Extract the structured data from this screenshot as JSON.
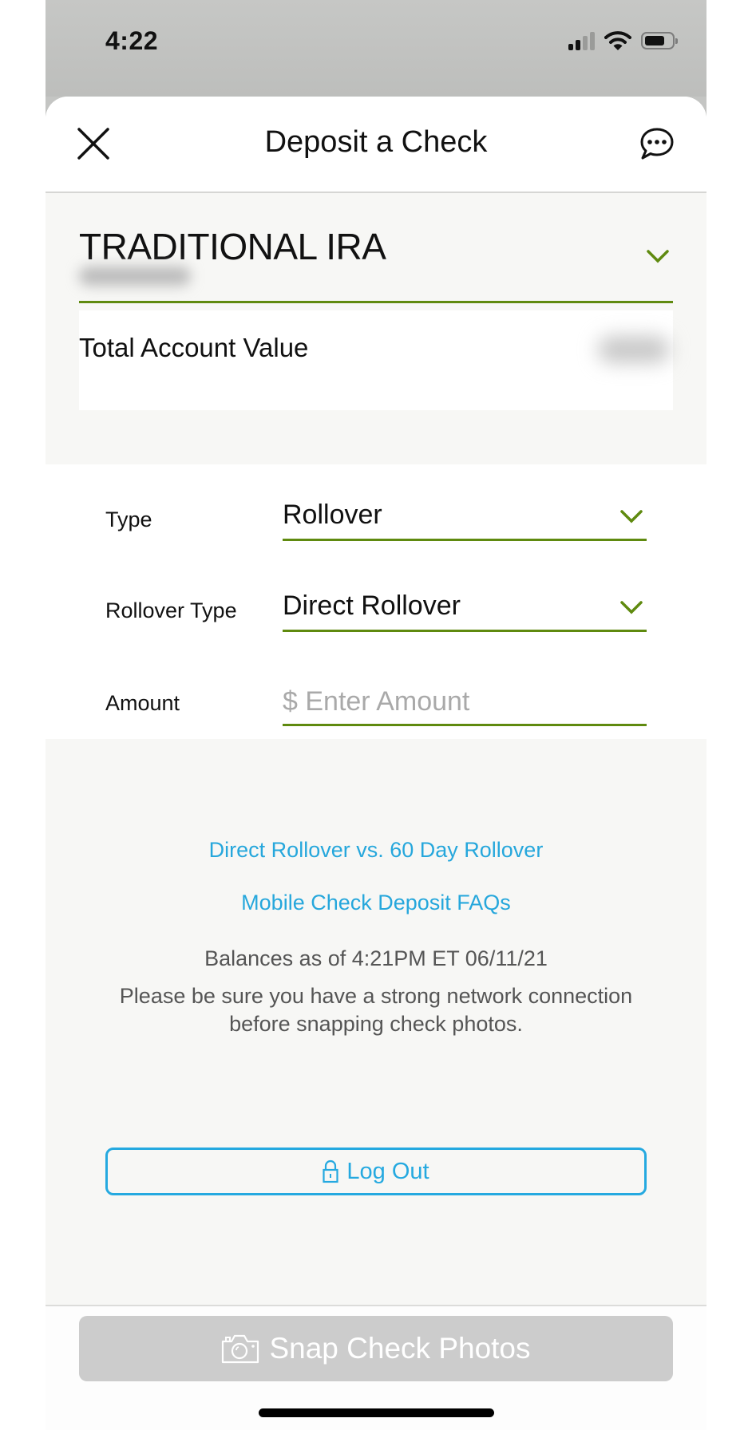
{
  "status_bar": {
    "time": "4:22",
    "signal_bars_active": 2,
    "signal_bars_total": 4,
    "battery_level_fraction": 0.75
  },
  "header": {
    "title": "Deposit a Check",
    "close_icon": "close-icon",
    "chat_icon": "chat-bubble-icon"
  },
  "account": {
    "name": "TRADITIONAL IRA",
    "number_redacted": true,
    "value_label": "Total Account Value",
    "value_redacted": true
  },
  "form": {
    "type": {
      "label": "Type",
      "value": "Rollover"
    },
    "rollover_type": {
      "label": "Rollover Type",
      "value": "Direct Rollover"
    },
    "amount": {
      "label": "Amount",
      "value": "",
      "placeholder": "$ Enter Amount"
    }
  },
  "info": {
    "links": [
      {
        "label": "Direct Rollover vs. 60 Day Rollover"
      },
      {
        "label": "Mobile Check Deposit FAQs"
      }
    ],
    "balances_as_of": "Balances as of 4:21PM ET 06/11/21",
    "network_note": "Please be sure you have a strong network connection before snapping check photos.",
    "logout_label": "Log Out"
  },
  "footer": {
    "snap_label": "Snap Check Photos",
    "snap_disabled": true
  },
  "colors": {
    "accent_green": "#5f8a0f",
    "link_blue": "#26a7dc",
    "disabled_gray": "#cccccc"
  }
}
